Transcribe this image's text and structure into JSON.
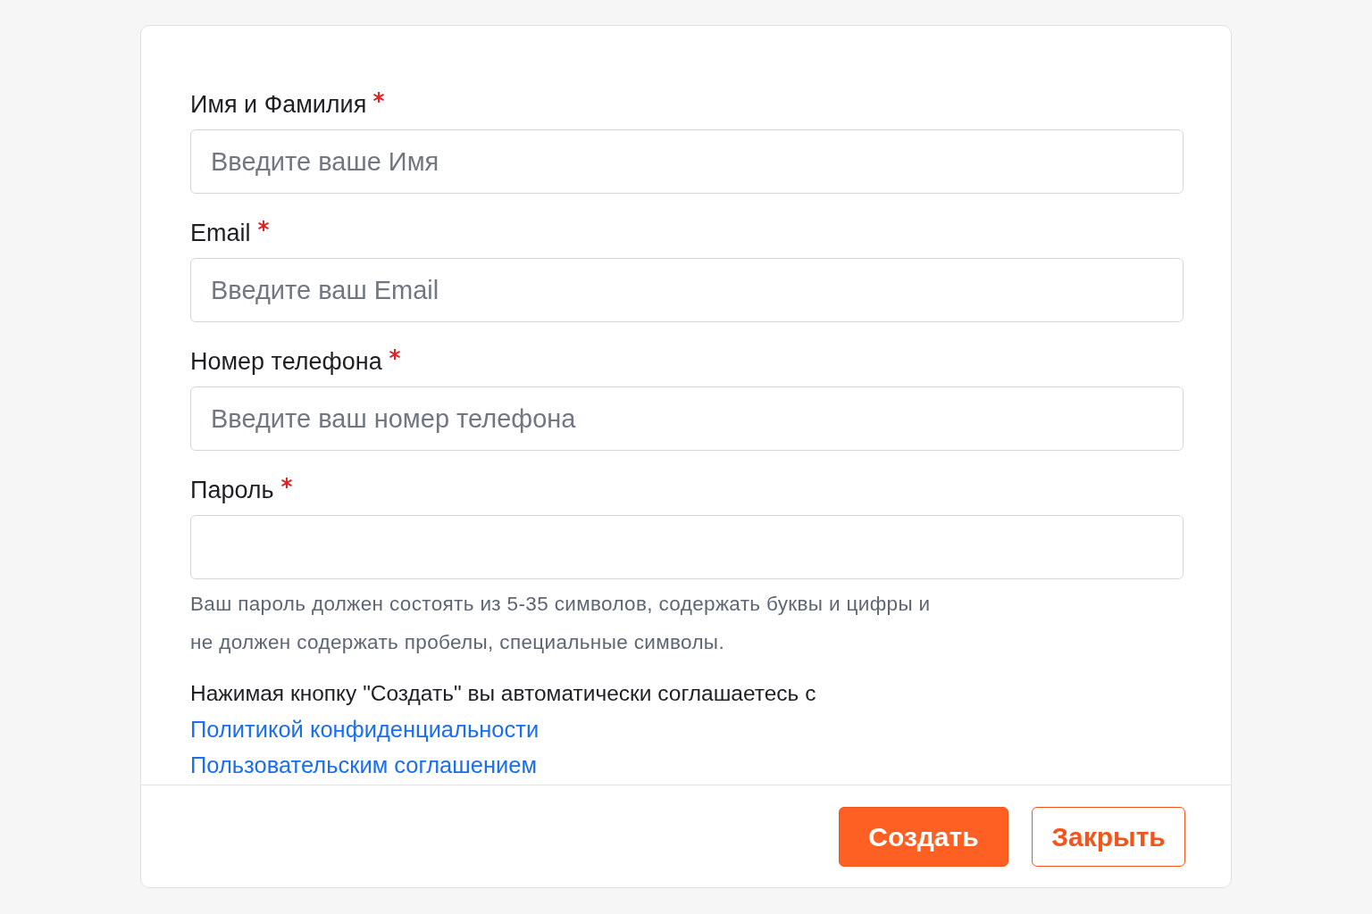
{
  "form": {
    "fields": [
      {
        "label": "Имя и Фамилия",
        "required": true,
        "placeholder": "Введите ваше Имя"
      },
      {
        "label": "Email",
        "required": true,
        "placeholder": "Введите ваш Email"
      },
      {
        "label": "Номер телефона",
        "required": true,
        "placeholder": "Введите ваш номер телефона"
      },
      {
        "label": "Пароль",
        "required": true
      }
    ],
    "password_hint": "Ваш пароль должен состоять из 5-35 символов, содержать буквы и цифры и не должен содержать пробелы, специальные символы.",
    "agreement": {
      "text": "Нажимая кнопку \"Создать\" вы автоматически соглашаетесь с",
      "links": [
        "Политикой конфиденциальности",
        "Пользовательским соглашением"
      ]
    },
    "buttons": [
      {
        "label": "Создать",
        "kind": "primary"
      },
      {
        "label": "Закрыть",
        "kind": "secondary"
      }
    ]
  }
}
